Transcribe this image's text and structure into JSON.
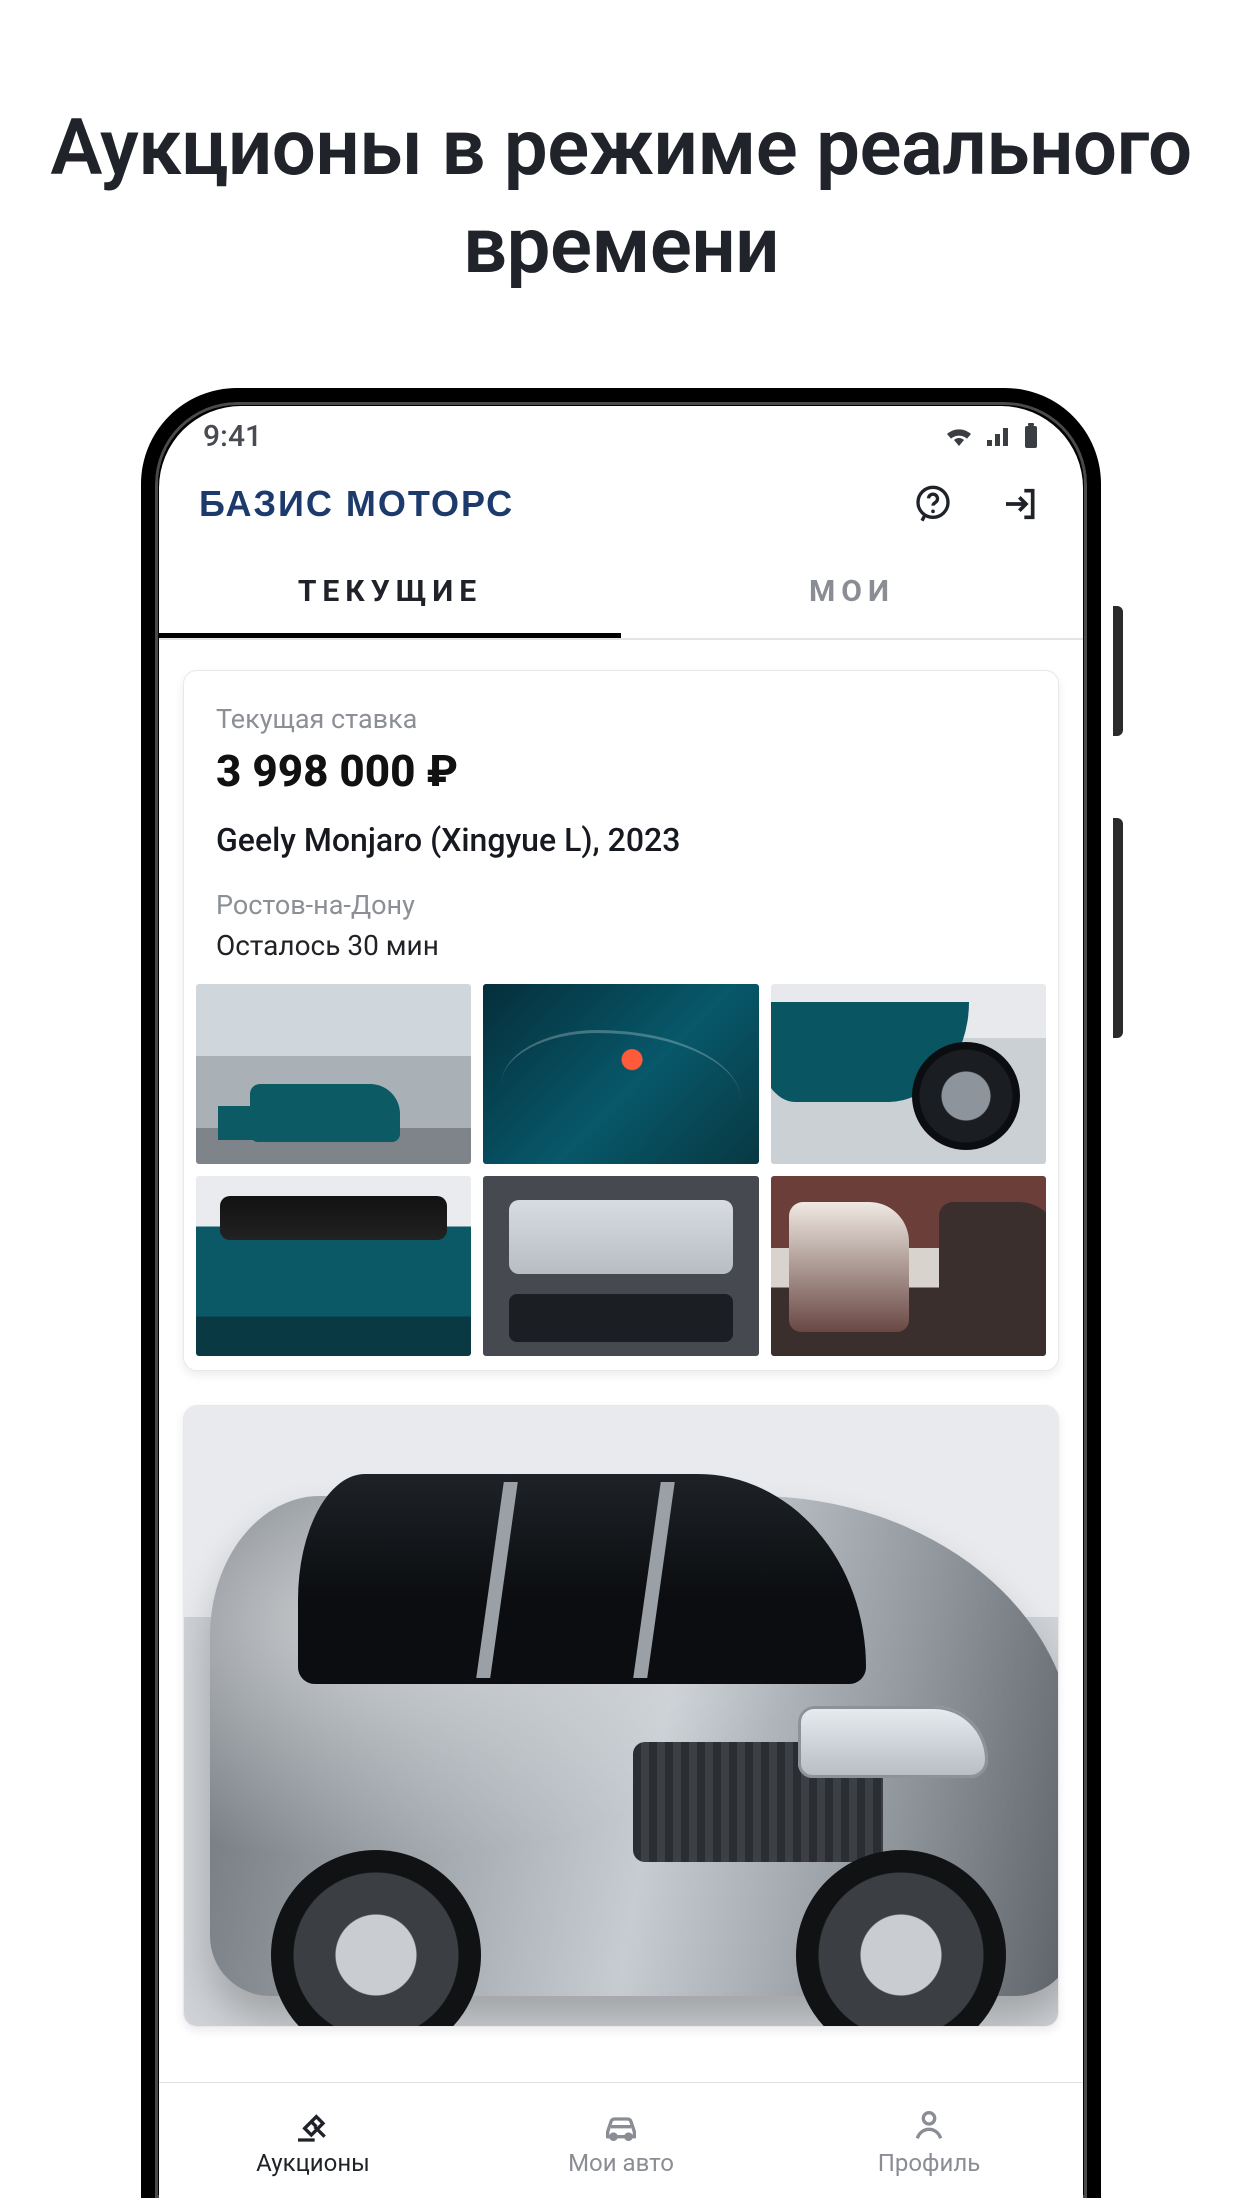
{
  "headline": "Аукционы в режиме реального времени",
  "statusbar": {
    "time": "9:41"
  },
  "header": {
    "brand": "БАЗИС МОТОРС"
  },
  "tabs": {
    "current": "ТЕКУЩИЕ",
    "mine": "МОИ"
  },
  "card1": {
    "bid_label": "Текущая ставка",
    "price": "3 998 000 ₽",
    "title": "Geely Monjaro (Xingyue L), 2023",
    "city": "Ростов-на-Дону",
    "time_left": "Осталось 30 мин"
  },
  "nav": {
    "auctions": "Аукционы",
    "my_cars": "Мои авто",
    "profile": "Профиль"
  }
}
